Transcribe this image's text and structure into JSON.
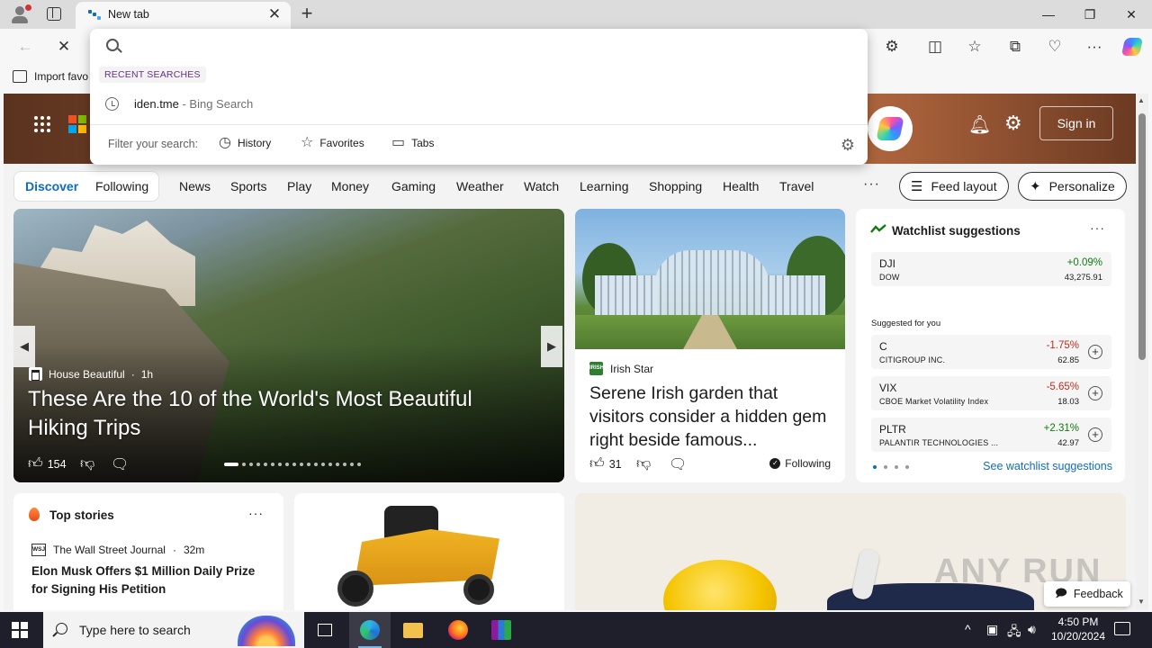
{
  "browser": {
    "tab_title": "New tab",
    "tab_close": "✕",
    "new_tab": "+",
    "window_controls": {
      "minimize": "—",
      "maximize": "❐",
      "close": "✕"
    }
  },
  "toolbar": {
    "back": "←",
    "stop": "✕",
    "extensions": "⚙",
    "split": "◫",
    "favorites": "☆",
    "collections": "⧉",
    "performance": "♡",
    "more": "···"
  },
  "favbar": {
    "import_label": "Import favo"
  },
  "omnibox": {
    "input_value": "",
    "recent_label": "RECENT SEARCHES",
    "suggestion": {
      "query": "iden.tme",
      "suffix": " - Bing Search"
    },
    "filter_label": "Filter your search:",
    "filters": [
      {
        "label": "History",
        "icon": "history-icon"
      },
      {
        "label": "Favorites",
        "icon": "star-icon"
      },
      {
        "label": "Tabs",
        "icon": "tabs-icon"
      }
    ]
  },
  "header": {
    "signin_label": "Sign in"
  },
  "nav": {
    "discover": "Discover",
    "following": "Following",
    "items": [
      "News",
      "Sports",
      "Play",
      "Money",
      "Gaming",
      "Weather",
      "Watch",
      "Learning",
      "Shopping",
      "Health",
      "Travel"
    ],
    "more": "···",
    "feed_layout": "Feed layout",
    "personalize": "Personalize"
  },
  "hero": {
    "source": "House Beautiful",
    "age": "1h",
    "title": "These Are the 10 of the World's Most Beautiful Hiking Trips",
    "likes": "154",
    "prev": "◀",
    "next": "▶"
  },
  "garden": {
    "source": "Irish Star",
    "source_logo": "IRISH",
    "title": "Serene Irish garden that visitors consider a hidden gem right beside famous...",
    "likes": "31",
    "following": "Following"
  },
  "watchlist": {
    "title": "Watchlist suggestions",
    "more": "···",
    "watched": {
      "symbol": "DJI",
      "name": "DOW",
      "change": "+0.09%",
      "price": "43,275.91",
      "trend": "up"
    },
    "suggested_label": "Suggested for you",
    "suggested": [
      {
        "symbol": "C",
        "name": "CITIGROUP INC.",
        "change": "-1.75%",
        "price": "62.85",
        "trend": "down"
      },
      {
        "symbol": "VIX",
        "name": "CBOE Market Volatility Index",
        "change": "-5.65%",
        "price": "18.03",
        "trend": "down"
      },
      {
        "symbol": "PLTR",
        "name": "PALANTIR TECHNOLOGIES ...",
        "change": "+2.31%",
        "price": "42.97",
        "trend": "up"
      }
    ],
    "see_more": "See watchlist suggestions"
  },
  "top_stories": {
    "title": "Top stories",
    "more": "···",
    "source_logo": "WSJ",
    "source": "The Wall Street Journal",
    "age": "32m",
    "headline": "Elon Musk Offers $1 Million Daily Prize for Signing His Petition"
  },
  "feedback_label": "Feedback",
  "watermark": "ANY RUN",
  "taskbar": {
    "search_placeholder": "Type here to search",
    "time": "4:50 PM",
    "date": "10/20/2024"
  },
  "colors": {
    "accent": "#0f6cbd",
    "up": "#0f7b0f",
    "down": "#c42b1c",
    "taskbar": "#1f1f2b"
  }
}
